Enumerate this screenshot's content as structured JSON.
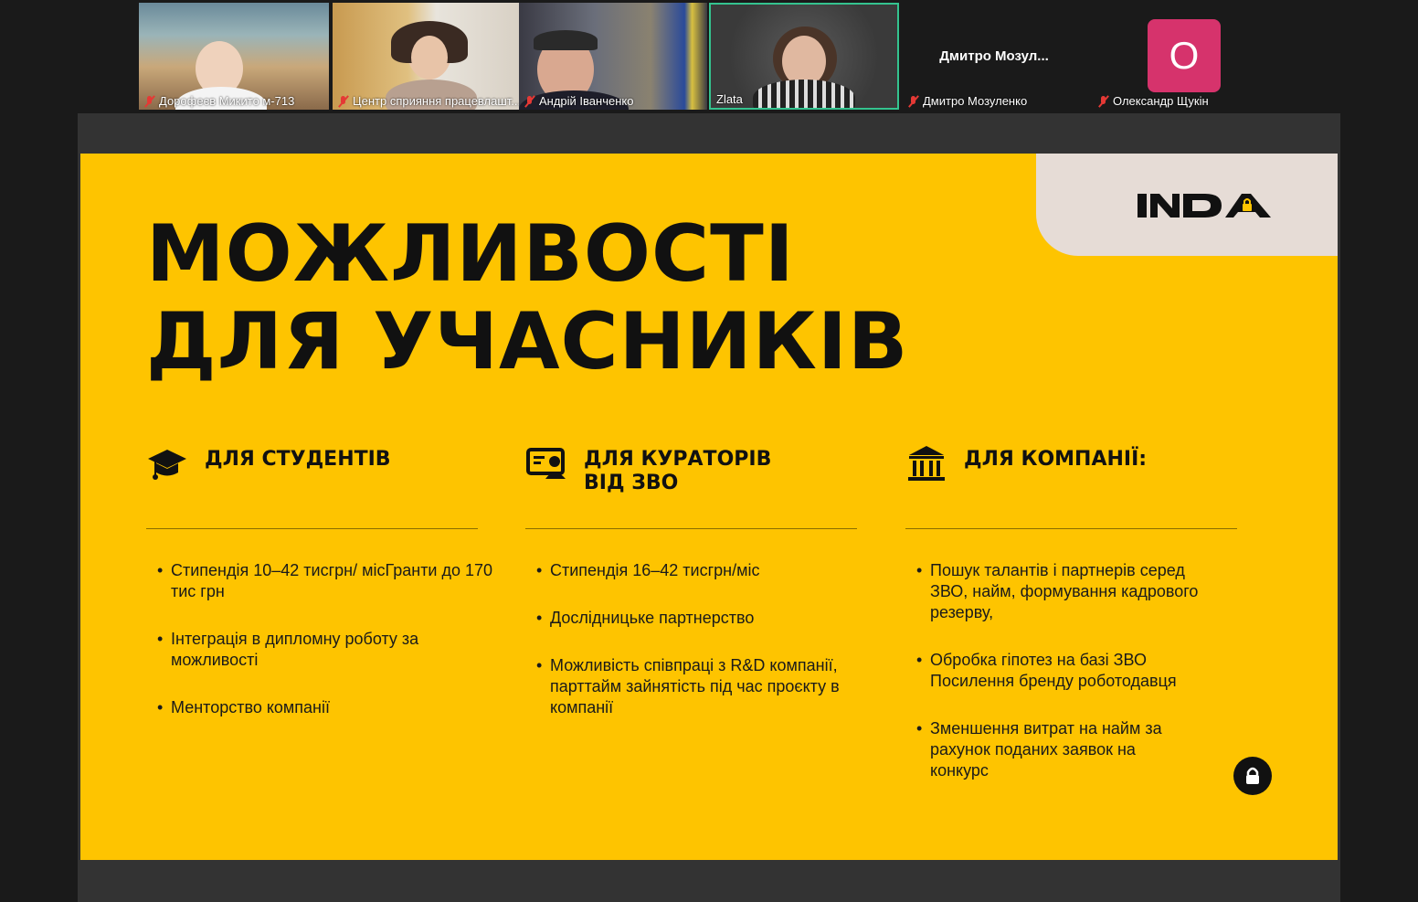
{
  "participants": [
    {
      "name": "Дорофеєв Микито м-713",
      "muted": true
    },
    {
      "name": "Центр сприяння працевлашт...",
      "muted": true
    },
    {
      "name": "Андрій Іванченко",
      "muted": true
    },
    {
      "name": "Zlata",
      "muted": false,
      "active_speaker": true
    },
    {
      "name": "Дмитро Мозуленко",
      "muted": true,
      "display_name": "Дмитро  Мозул..."
    },
    {
      "name": "Олександр Щукін",
      "muted": true,
      "avatar_letter": "О",
      "avatar_color": "#d6336c"
    }
  ],
  "slide": {
    "background": "#fec400",
    "logo": "nda-logo",
    "title_line1": "МОЖЛИВОСТІ",
    "title_line2": "ДЛЯ УЧАСНИКІВ",
    "columns": [
      {
        "icon": "graduation-cap-icon",
        "heading": "ДЛЯ СТУДЕНТІВ",
        "items": [
          "Стипендія 10–42 тисгрн/ місГранти до 170 тис грн",
          "Інтеграція в дипломну роботу за можливості",
          " Менторство компанії"
        ]
      },
      {
        "icon": "presentation-person-icon",
        "heading": "ДЛЯ КУРАТОРІВ ВІД ЗВО",
        "items": [
          "Стипендія 16–42 тисгрн/міс",
          "Дослідницьке партнерство",
          "Можливість співпраці з R&D компанії, парттайм зайнятість під час проєкту в компанії"
        ]
      },
      {
        "icon": "institution-icon",
        "heading": "ДЛЯ КОМПАНІЇ:",
        "items": [
          "Пошук талантів і партнерів серед ЗВО, найм, формування кадрового резерву,",
          "Обробка гіпотез на базі ЗВО Посилення бренду роботодавця",
          "Зменшення витрат на найм за рахунок поданих заявок на конкурс"
        ]
      }
    ]
  }
}
